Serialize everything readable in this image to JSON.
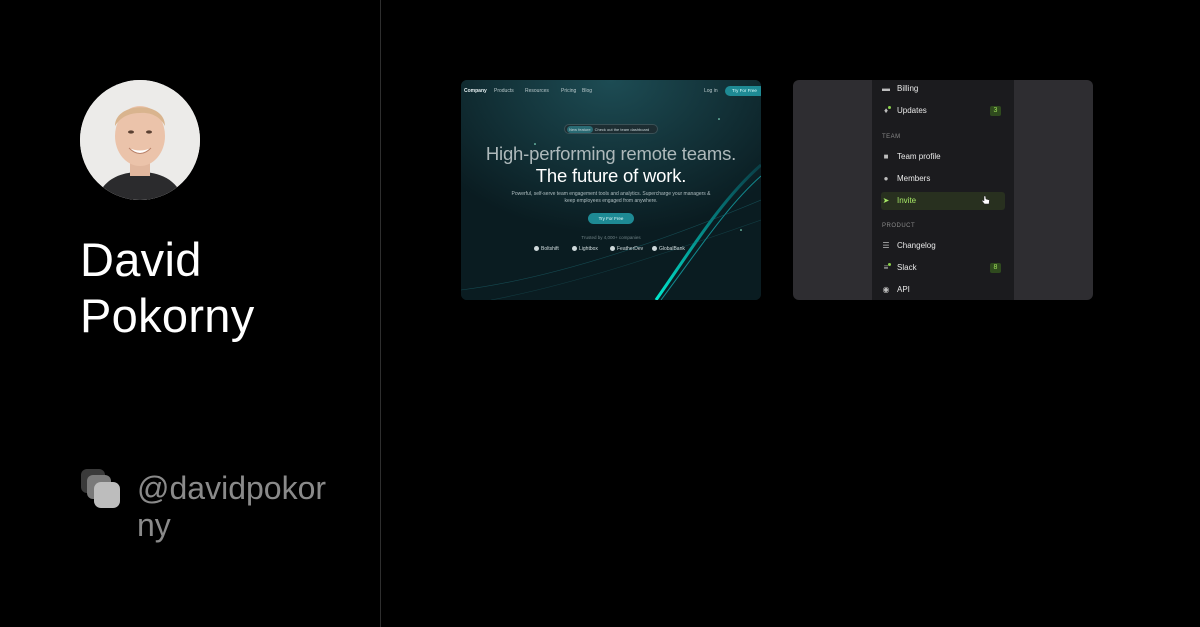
{
  "profile": {
    "name": "David Pokorny",
    "handle": "@davidpokorny"
  },
  "card_landing": {
    "nav": {
      "logo": "Company",
      "items": [
        "Products",
        "Resources",
        "Pricing",
        "Blog"
      ],
      "login": "Log in",
      "cta": "Try For Free"
    },
    "badge_tag": "New feature",
    "badge_text": "Check out the team dashboard",
    "headline_1": "High-performing remote teams.",
    "headline_2": "The future of work.",
    "subtext": "Powerful, self-serve team engagement tools and analytics. Supercharge your managers & keep employees engaged from anywhere.",
    "cta": "Try For Free",
    "trusted": "Trusted by 4,000+ companies",
    "logos": [
      "Boltshift",
      "Lightbox",
      "FeatherDev",
      "GlobalBank"
    ]
  },
  "card_menu": {
    "items": [
      {
        "label": "Billing"
      },
      {
        "label": "Updates",
        "count": "3"
      },
      {
        "label": "Team profile"
      },
      {
        "label": "Members"
      },
      {
        "label": "Invite"
      },
      {
        "label": "Changelog"
      },
      {
        "label": "Slack",
        "count": "8"
      },
      {
        "label": "API"
      }
    ],
    "sections": [
      "TEAM",
      "PRODUCT"
    ]
  },
  "colors": {
    "background": "#000000",
    "handle_text": "#8a8a8a",
    "accent_teal": "#1e8a94",
    "accent_green": "#a6e866"
  }
}
